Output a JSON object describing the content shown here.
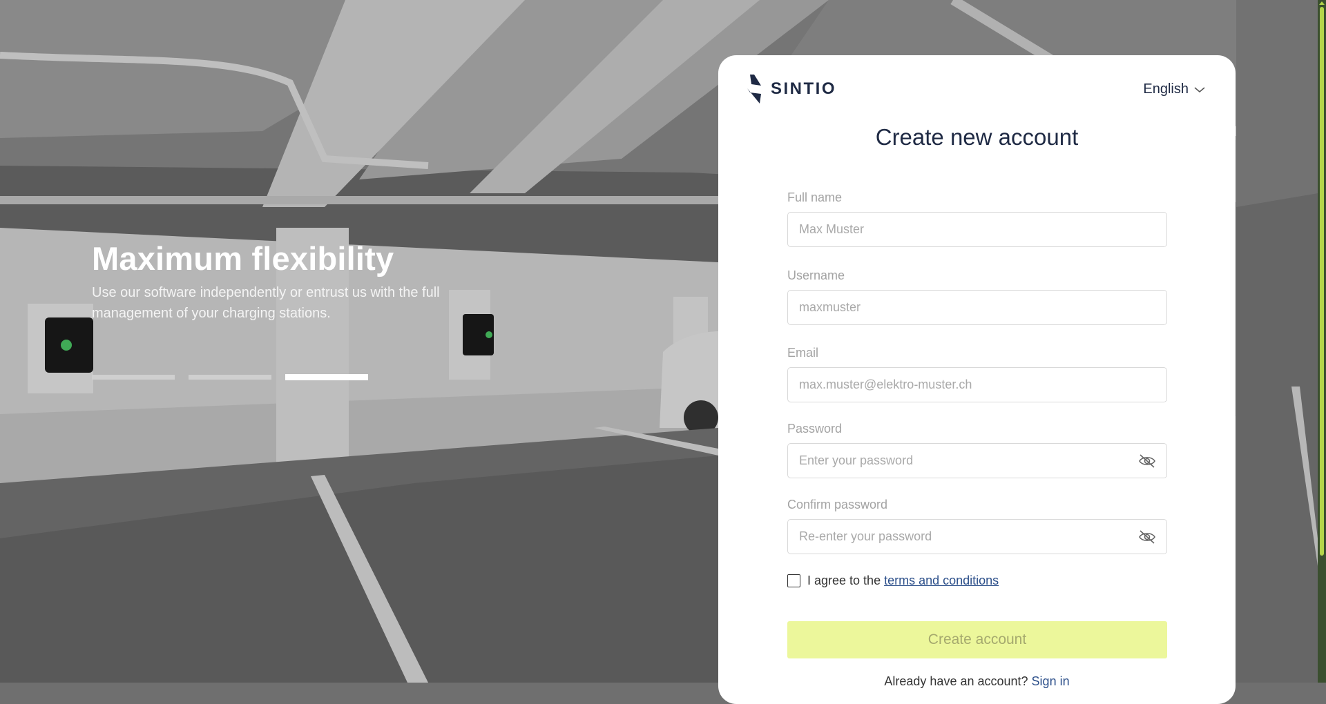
{
  "hero": {
    "title": "Maximum flexibility",
    "subtitle": "Use our software independently or entrust us with the full management of your charging stations.",
    "slides": [
      {
        "active": false
      },
      {
        "active": false
      },
      {
        "active": true
      }
    ]
  },
  "brand": {
    "name": "SINTIO",
    "color": "#1f2a44"
  },
  "language": {
    "selected": "English",
    "icon": "chevron-down-icon"
  },
  "form": {
    "title": "Create new account",
    "full_name": {
      "label": "Full name",
      "placeholder": "Max Muster"
    },
    "username": {
      "label": "Username",
      "placeholder": "maxmuster"
    },
    "email": {
      "label": "Email",
      "placeholder": "max.muster@elektro-muster.ch"
    },
    "password": {
      "label": "Password",
      "placeholder": "Enter your password",
      "icon": "eye-off-icon"
    },
    "confirm_password": {
      "label": "Confirm password",
      "placeholder": "Re-enter your password",
      "icon": "eye-off-icon"
    },
    "agree_prefix": "I agree to the ",
    "terms_link": "terms and conditions",
    "submit_label": "Create account",
    "signin_prefix": "Already have an account? ",
    "signin_link": "Sign in"
  },
  "colors": {
    "accent": "#ecf79b",
    "link": "#2c4f8a",
    "scrollbar": "#b4d64a"
  }
}
